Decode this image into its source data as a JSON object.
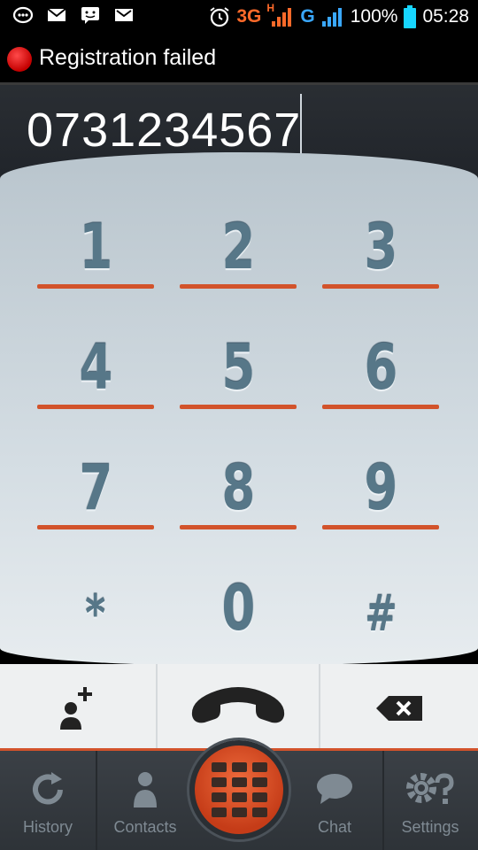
{
  "status_bar": {
    "battery": "100%",
    "time": "05:28",
    "network_3g": "3G",
    "network_h": "H",
    "network_g": "G"
  },
  "registration": {
    "text": "Registration failed",
    "color": "#e00000"
  },
  "display": {
    "number": "0731234567"
  },
  "keypad": {
    "keys": [
      {
        "label": "1"
      },
      {
        "label": "2"
      },
      {
        "label": "3"
      },
      {
        "label": "4"
      },
      {
        "label": "5"
      },
      {
        "label": "6"
      },
      {
        "label": "7"
      },
      {
        "label": "8"
      },
      {
        "label": "9"
      },
      {
        "label": "*"
      },
      {
        "label": "0"
      },
      {
        "label": "#"
      }
    ],
    "accent": "#d2532b"
  },
  "actions": {
    "add_contact_icon": "add-contact-icon",
    "call_icon": "phone-handset-icon",
    "backspace_icon": "backspace-icon"
  },
  "nav": {
    "items": [
      {
        "label": "History",
        "icon": "refresh-icon"
      },
      {
        "label": "Contacts",
        "icon": "person-icon"
      },
      {
        "label": "Chat",
        "icon": "chat-bubble-icon"
      },
      {
        "label": "Settings",
        "icon": "gear-question-icon"
      }
    ],
    "center_icon": "dialpad-icon"
  }
}
